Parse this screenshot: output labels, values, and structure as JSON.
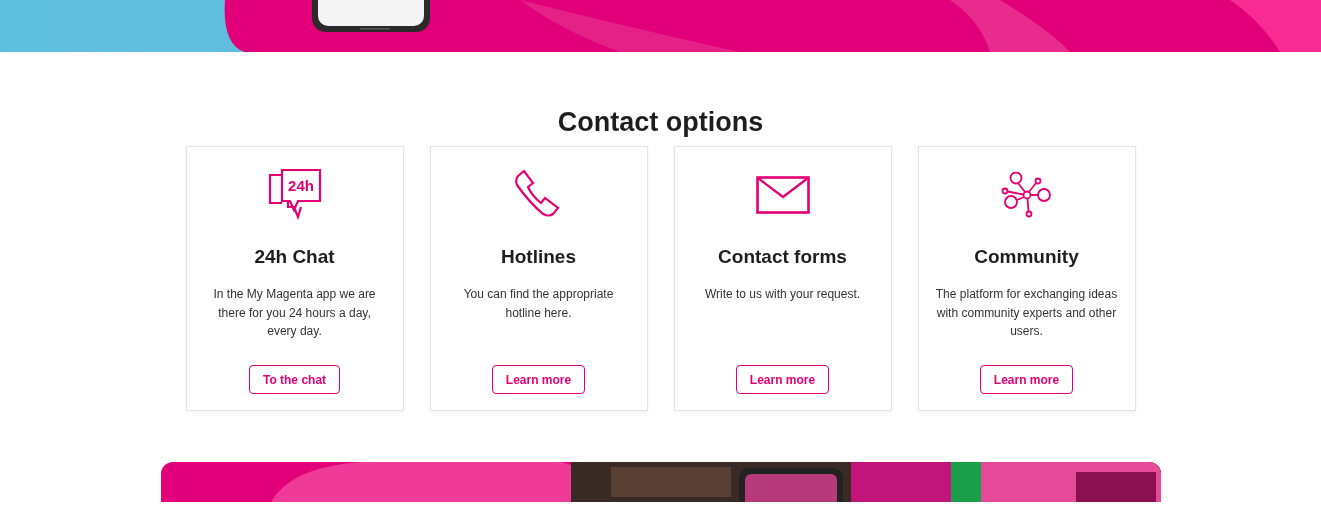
{
  "heading": "Contact options",
  "cards": [
    {
      "kind": "chat",
      "icon_label": "24h",
      "title": "24h Chat",
      "text": "In the My Magenta app we are there for you 24 hours a day, every day.",
      "button": "To the chat"
    },
    {
      "kind": "phone",
      "title": "Hotlines",
      "text": "You can find the appropriate hotline here.",
      "button": "Learn more"
    },
    {
      "kind": "mail",
      "title": "Contact forms",
      "text": "Write to us with your request.",
      "button": "Learn more"
    },
    {
      "kind": "community",
      "title": "Community",
      "text": "The platform for exchanging ideas with community experts and other users.",
      "button": "Learn more"
    }
  ]
}
